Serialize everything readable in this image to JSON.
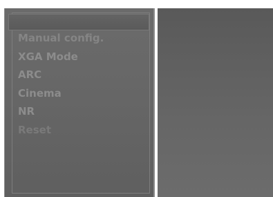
{
  "menu": {
    "items": [
      {
        "label": "Manual config.",
        "enabled": true
      },
      {
        "label": "XGA Mode",
        "enabled": true
      },
      {
        "label": "ARC",
        "enabled": true
      },
      {
        "label": "Cinema",
        "enabled": true
      },
      {
        "label": "NR",
        "enabled": true
      },
      {
        "label": "Reset",
        "enabled": false
      }
    ]
  },
  "colors": {
    "panel": "#676767",
    "side_panel": "#636363",
    "item_text": "#8c8c8c",
    "disabled_text": "#7a7a7a"
  }
}
